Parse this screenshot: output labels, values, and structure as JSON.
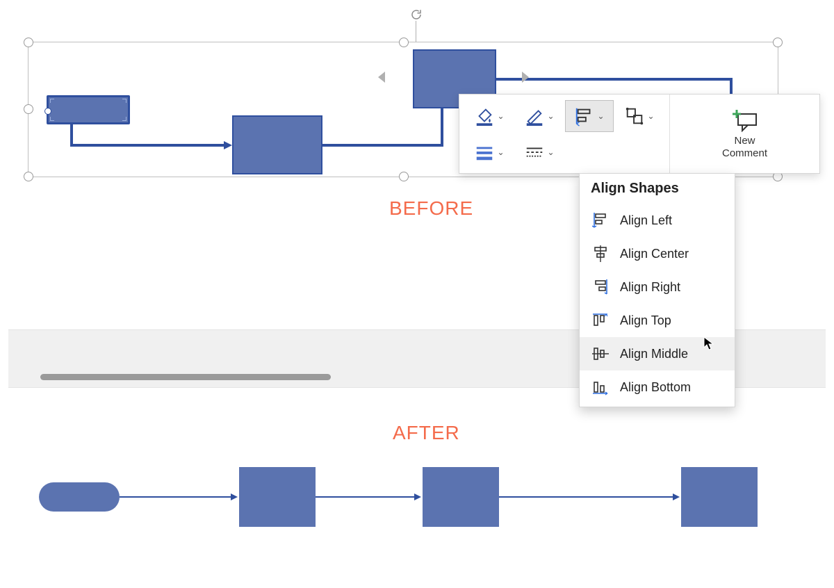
{
  "labels": {
    "before": "BEFORE",
    "after": "AFTER"
  },
  "toolbar": {
    "new_comment": "New\nComment"
  },
  "dropdown": {
    "title": "Align Shapes",
    "items": [
      {
        "label": "Align Left"
      },
      {
        "label": "Align Center"
      },
      {
        "label": "Align Right"
      },
      {
        "label": "Align Top"
      },
      {
        "label": "Align Middle"
      },
      {
        "label": "Align Bottom"
      }
    ],
    "hover_index": 4
  },
  "colors": {
    "shape_fill": "#5B73B0",
    "shape_border": "#2F4F9E",
    "accent_orange": "#F46B4B"
  }
}
